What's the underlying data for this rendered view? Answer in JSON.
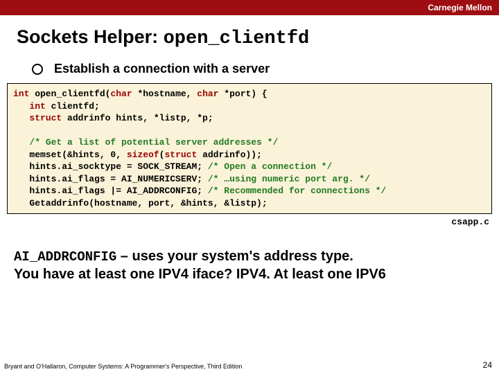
{
  "header": {
    "brand": "Carnegie Mellon"
  },
  "title": {
    "plain": "Sockets Helper: ",
    "code": "open_clientfd"
  },
  "bullet": {
    "text": "Establish a connection with a server"
  },
  "code": {
    "l1a": "int",
    "l1b": " open_clientfd(",
    "l1c": "char",
    "l1d": " *hostname, ",
    "l1e": "char",
    "l1f": " *port) {",
    "l2a": "int",
    "l2b": " clientfd;",
    "l3a": "struct",
    "l3b": " addrinfo hints, *listp, *p;",
    "l5a": "/* Get a list of potential server addresses */",
    "l6a": "memset(&hints, 0, ",
    "l6b": "sizeof",
    "l6c": "(",
    "l6d": "struct",
    "l6e": " addrinfo));",
    "l7a": "hints.ai_socktype = SOCK_STREAM;  ",
    "l7b": "/* Open a connection */",
    "l8a": "hints.ai_flags = AI_NUMERICSERV;  ",
    "l8b": "/* …using numeric port arg. */",
    "l9a": "hints.ai_flags |= AI_ADDRCONFIG;  ",
    "l9b": "/* Recommended for connections */",
    "l10a": "Getaddrinfo(hostname, port, &hints, &listp);"
  },
  "file": "csapp.c",
  "note": {
    "code": "AI_ADDRCONFIG",
    "dash": " – ",
    "line1": "uses your system's address type.",
    "line2": "You have at least one IPV4 iface? IPV4.  At least one IPV6"
  },
  "footer": {
    "left": "Bryant and O'Hallaron, Computer Systems: A Programmer's Perspective, Third Edition",
    "page": "24"
  }
}
